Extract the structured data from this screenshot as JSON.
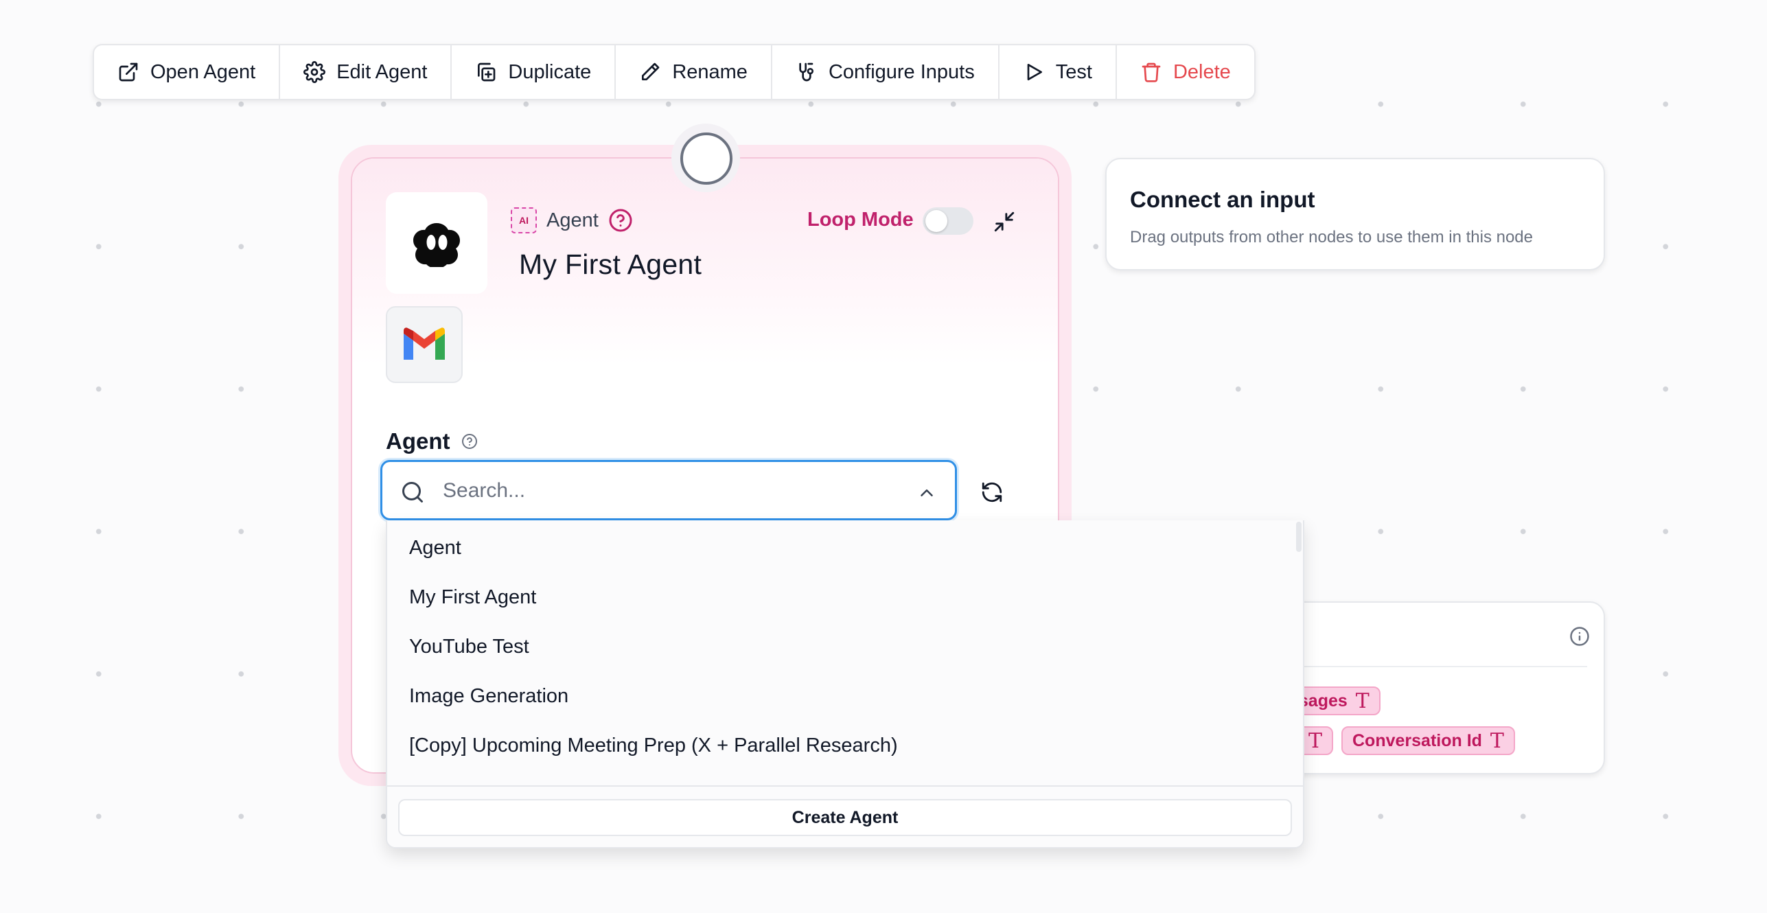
{
  "toolbar": {
    "open_agent": "Open Agent",
    "edit_agent": "Edit Agent",
    "duplicate": "Duplicate",
    "rename": "Rename",
    "configure_inputs": "Configure Inputs",
    "test": "Test",
    "delete": "Delete"
  },
  "node": {
    "type_label": "Agent",
    "title": "My First Agent",
    "loop_mode_label": "Loop Mode",
    "loop_mode_on": false,
    "field_label": "Agent",
    "search_placeholder": "Search...",
    "search_value": ""
  },
  "connect": {
    "title": "Connect an input",
    "subtitle": "Drag outputs from other nodes to use them in this node"
  },
  "outputs": {
    "chips": [
      "ssages",
      "Conversation Id"
    ]
  },
  "dropdown": {
    "items": [
      "Agent",
      "My First Agent",
      "YouTube Test",
      "Image Generation",
      "[Copy] Upcoming Meeting Prep (X + Parallel Research)"
    ],
    "create_label": "Create Agent"
  },
  "colors": {
    "accent_pink": "#c0216b",
    "delete_red": "#e5484d",
    "focus_blue": "#2f8fe6"
  }
}
